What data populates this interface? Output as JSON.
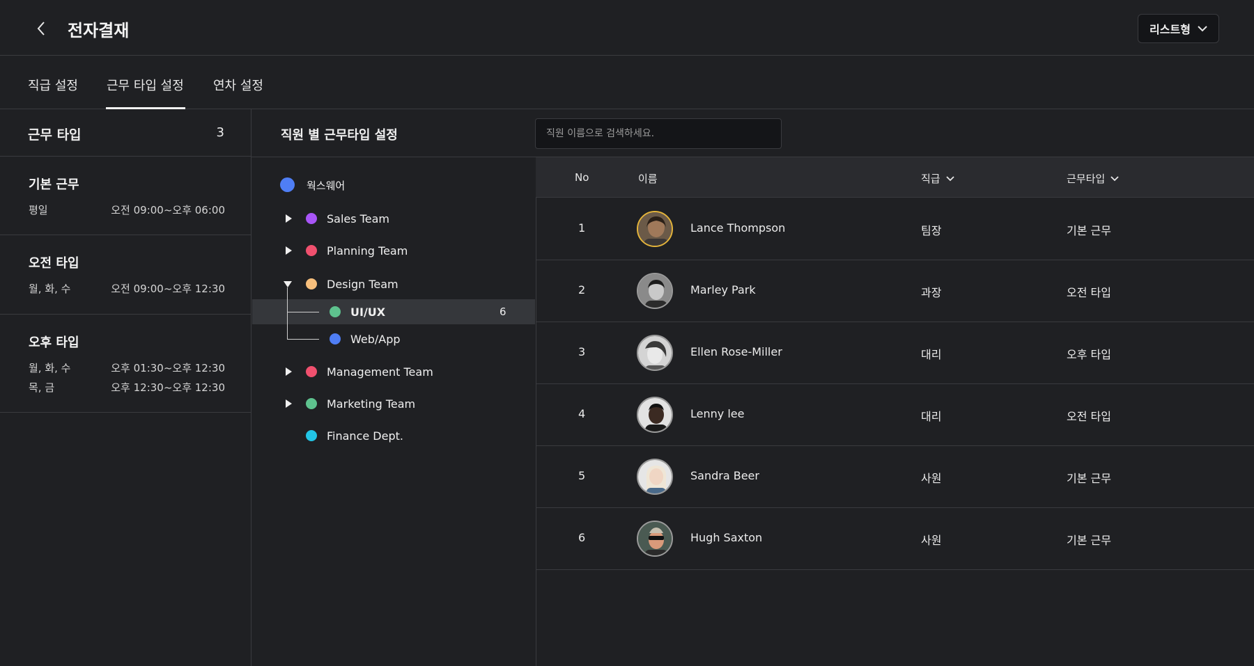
{
  "header": {
    "title": "전자결재",
    "view_select": "리스트형"
  },
  "tabs": [
    {
      "label": "직급 설정"
    },
    {
      "label": "근무 타입 설정"
    },
    {
      "label": "연차 설정"
    }
  ],
  "work_types": {
    "title": "근무 타입",
    "count": "3",
    "items": [
      {
        "name": "기본 근무",
        "rows": [
          {
            "days": "평일",
            "time": "오전 09:00~오후 06:00"
          }
        ]
      },
      {
        "name": "오전 타입",
        "rows": [
          {
            "days": "월, 화, 수",
            "time": "오전 09:00~오후 12:30"
          }
        ]
      },
      {
        "name": "오후 타입",
        "rows": [
          {
            "days": "월, 화, 수",
            "time": "오후 01:30~오후 12:30"
          },
          {
            "days": "목, 금",
            "time": "오후 12:30~오후 12:30"
          }
        ]
      }
    ]
  },
  "employee_settings": {
    "title": "직원 별 근무타입 설정",
    "search_placeholder": "직원 이름으로 검색하세요."
  },
  "org_tree": {
    "root": {
      "label": "웍스웨어",
      "color": "#4f7ef5"
    },
    "teams": [
      {
        "label": "Sales Team",
        "color": "#a855f7",
        "expanded": false
      },
      {
        "label": "Planning Team",
        "color": "#f0506e",
        "expanded": false
      },
      {
        "label": "Design Team",
        "color": "#f7bf7c",
        "expanded": true
      },
      {
        "label": "UI/UX",
        "color": "#5ec28e",
        "count": "6",
        "selected": true
      },
      {
        "label": "Web/App",
        "color": "#4f7ef5"
      },
      {
        "label": "Management Team",
        "color": "#f0506e",
        "expanded": false
      },
      {
        "label": "Marketing Team",
        "color": "#5ec28e",
        "expanded": false
      },
      {
        "label": "Finance Dept.",
        "color": "#22c5e6"
      }
    ]
  },
  "table": {
    "columns": {
      "no": "No",
      "name": "이름",
      "rank": "직급",
      "work_type": "근무타입"
    },
    "rows": [
      {
        "no": "1",
        "name": "Lance Thompson",
        "rank": "팀장",
        "work_type": "기본 근무"
      },
      {
        "no": "2",
        "name": "Marley Park",
        "rank": "과장",
        "work_type": "오전 타입"
      },
      {
        "no": "3",
        "name": "Ellen Rose-Miller",
        "rank": "대리",
        "work_type": "오후 타입"
      },
      {
        "no": "4",
        "name": "Lenny lee",
        "rank": "대리",
        "work_type": "오전 타입"
      },
      {
        "no": "5",
        "name": "Sandra Beer",
        "rank": "사원",
        "work_type": "기본 근무"
      },
      {
        "no": "6",
        "name": "Hugh Saxton",
        "rank": "사원",
        "work_type": "기본 근무"
      }
    ]
  }
}
